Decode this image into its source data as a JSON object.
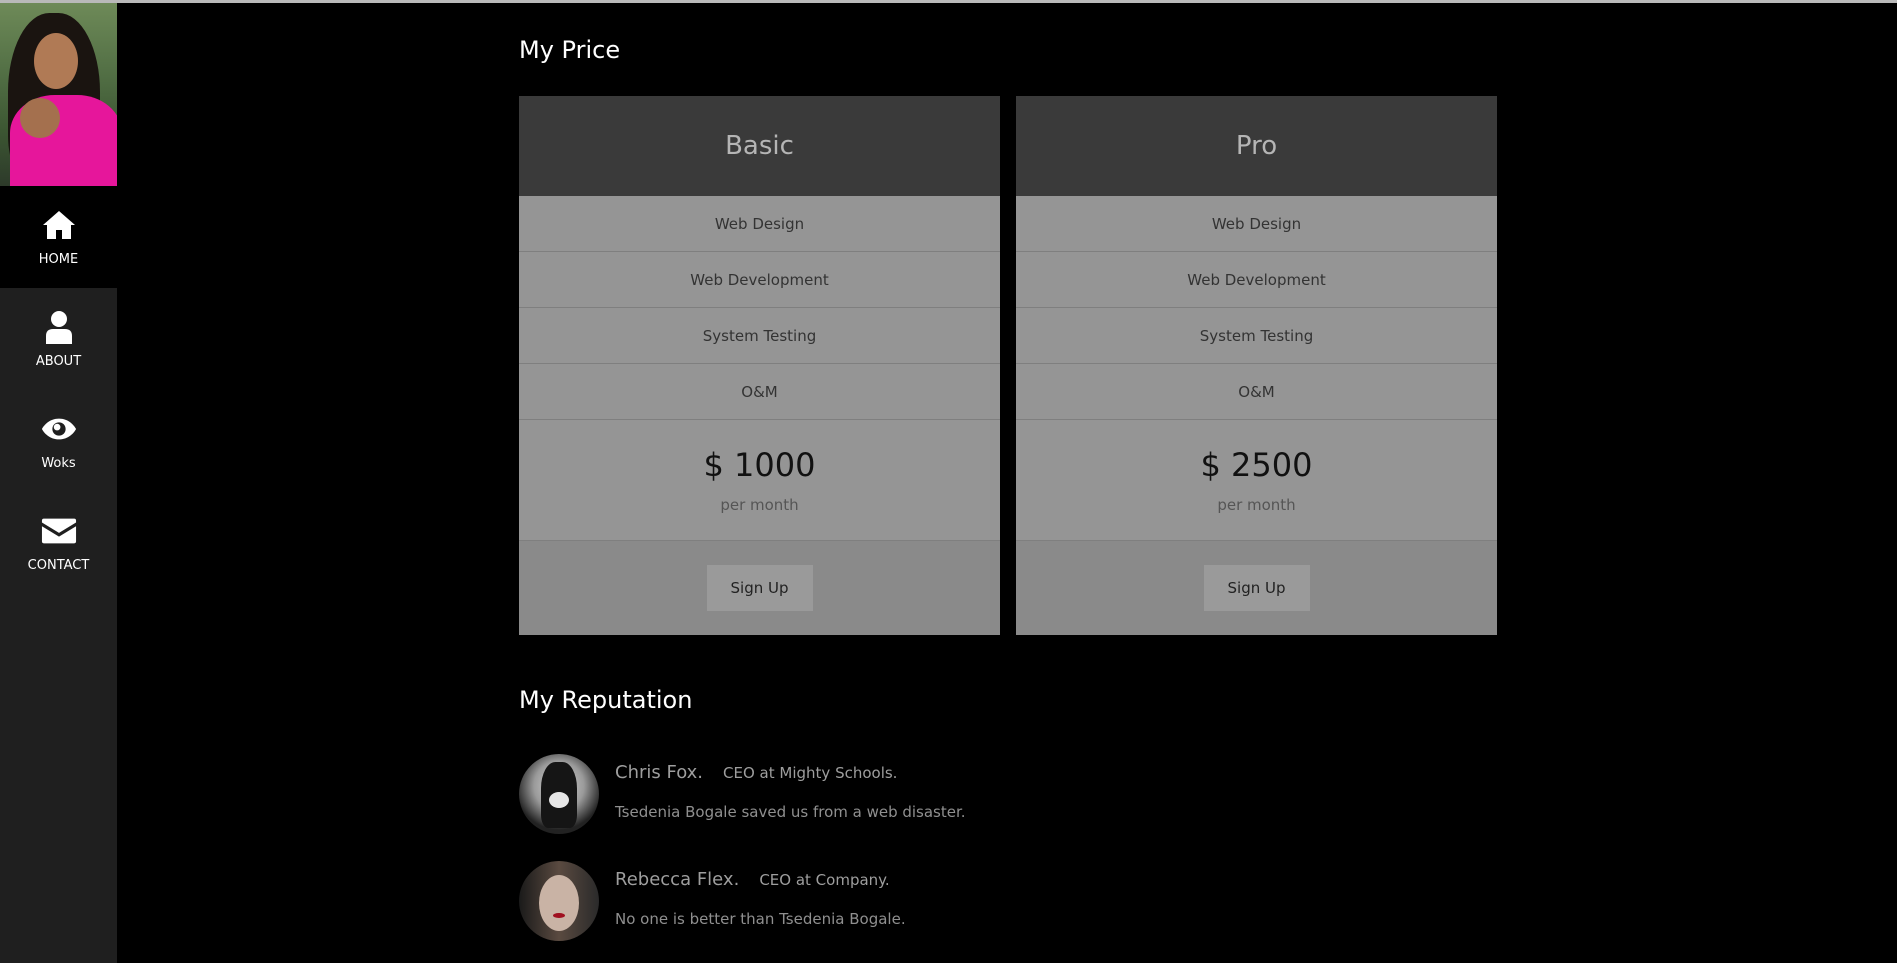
{
  "sidebar": {
    "items": [
      {
        "label": "HOME",
        "icon": "home-icon",
        "active": true
      },
      {
        "label": "ABOUT",
        "icon": "user-icon",
        "active": false
      },
      {
        "label": "Woks",
        "icon": "eye-icon",
        "active": false
      },
      {
        "label": "CONTACT",
        "icon": "envelope-icon",
        "active": false
      }
    ]
  },
  "pricing": {
    "title": "My Price",
    "plans": [
      {
        "name": "Basic",
        "features": [
          "Web Design",
          "Web Development",
          "System Testing",
          "O&M"
        ],
        "price": "$ 1000",
        "period": "per month",
        "cta": "Sign Up"
      },
      {
        "name": "Pro",
        "features": [
          "Web Design",
          "Web Development",
          "System Testing",
          "O&M"
        ],
        "price": "$ 2500",
        "period": "per month",
        "cta": "Sign Up"
      }
    ]
  },
  "reputation": {
    "title": "My Reputation",
    "reviews": [
      {
        "name": "Chris Fox.",
        "role": "CEO at Mighty Schools.",
        "quote": "Tsedenia Bogale saved us from a web disaster."
      },
      {
        "name": "Rebecca Flex.",
        "role": "CEO at Company.",
        "quote": "No one is better than Tsedenia Bogale."
      }
    ]
  },
  "colors": {
    "background": "#000000",
    "sidebar": "#1f1f1f",
    "card_head": "#3a3a3a",
    "card_body": "#959595"
  }
}
